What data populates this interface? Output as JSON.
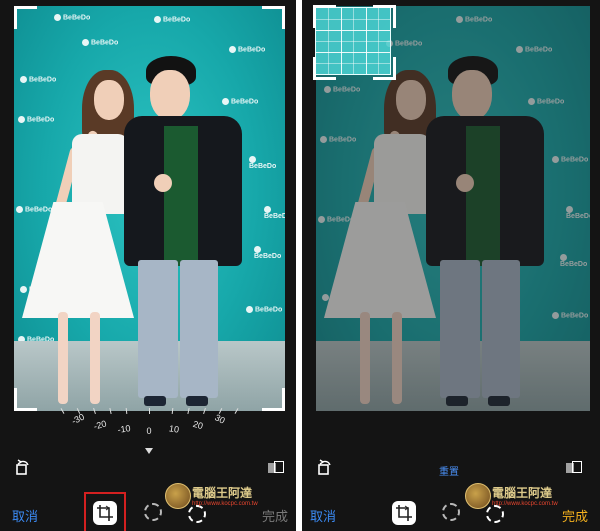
{
  "left": {
    "dial": {
      "labels": [
        "-30",
        "-20",
        "-10",
        "0",
        "10",
        "20",
        "30"
      ]
    },
    "toolbar": {
      "cancel_label": "取消",
      "done_label": "完成"
    }
  },
  "right": {
    "toolbar": {
      "cancel_label": "取消",
      "done_label": "完成",
      "reset_label": "重置"
    }
  },
  "backdrop": {
    "logo_text": "BeBeDo"
  },
  "watermark": {
    "title": "電腦王阿達",
    "url": "http://www.kocpc.com.tw"
  },
  "colors": {
    "cancel": "#3b8bf5",
    "done_right": "#f2b01e",
    "done_left": "#7a7a7a",
    "highlight": "#d42020"
  }
}
